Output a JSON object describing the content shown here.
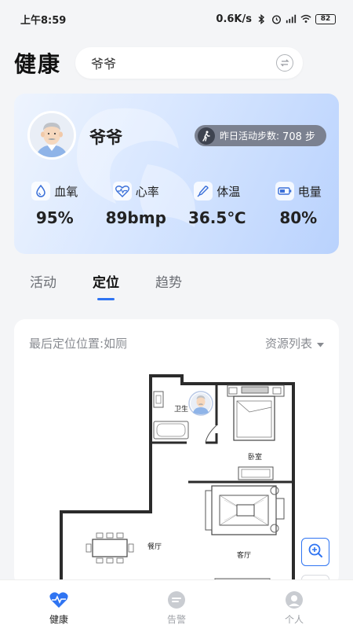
{
  "status": {
    "time": "上午8:59",
    "speed": "0.6K/s",
    "battery": "82"
  },
  "header": {
    "title": "健康",
    "search_value": "爷爷"
  },
  "profile": {
    "name": "爷爷",
    "steps_label": "昨日活动步数:",
    "steps_value": "708 步",
    "vitals": [
      {
        "label": "血氧",
        "value": "95%",
        "icon": "droplet-icon"
      },
      {
        "label": "心率",
        "value": "89bmp",
        "icon": "heart-rate-icon"
      },
      {
        "label": "体温",
        "value": "36.5℃",
        "icon": "thermometer-icon"
      },
      {
        "label": "电量",
        "value": "80%",
        "icon": "battery-icon"
      }
    ]
  },
  "tabs": [
    "活动",
    "定位",
    "趋势"
  ],
  "active_tab": "定位",
  "map": {
    "last_location": "最后定位位置:如厕",
    "resource_list": "资源列表",
    "rooms": {
      "bathroom": "卫生",
      "bedroom": "卧室",
      "dining": "餐厅",
      "living": "客厅"
    }
  },
  "nav": [
    {
      "label": "健康",
      "icon": "heart-pulse-icon",
      "active": true
    },
    {
      "label": "告警",
      "icon": "alert-icon",
      "active": false
    },
    {
      "label": "个人",
      "icon": "person-icon",
      "active": false
    }
  ],
  "colors": {
    "accent": "#2f74f2",
    "card_gradient_end": "#b9d2fd",
    "badge": "#7b8190"
  }
}
